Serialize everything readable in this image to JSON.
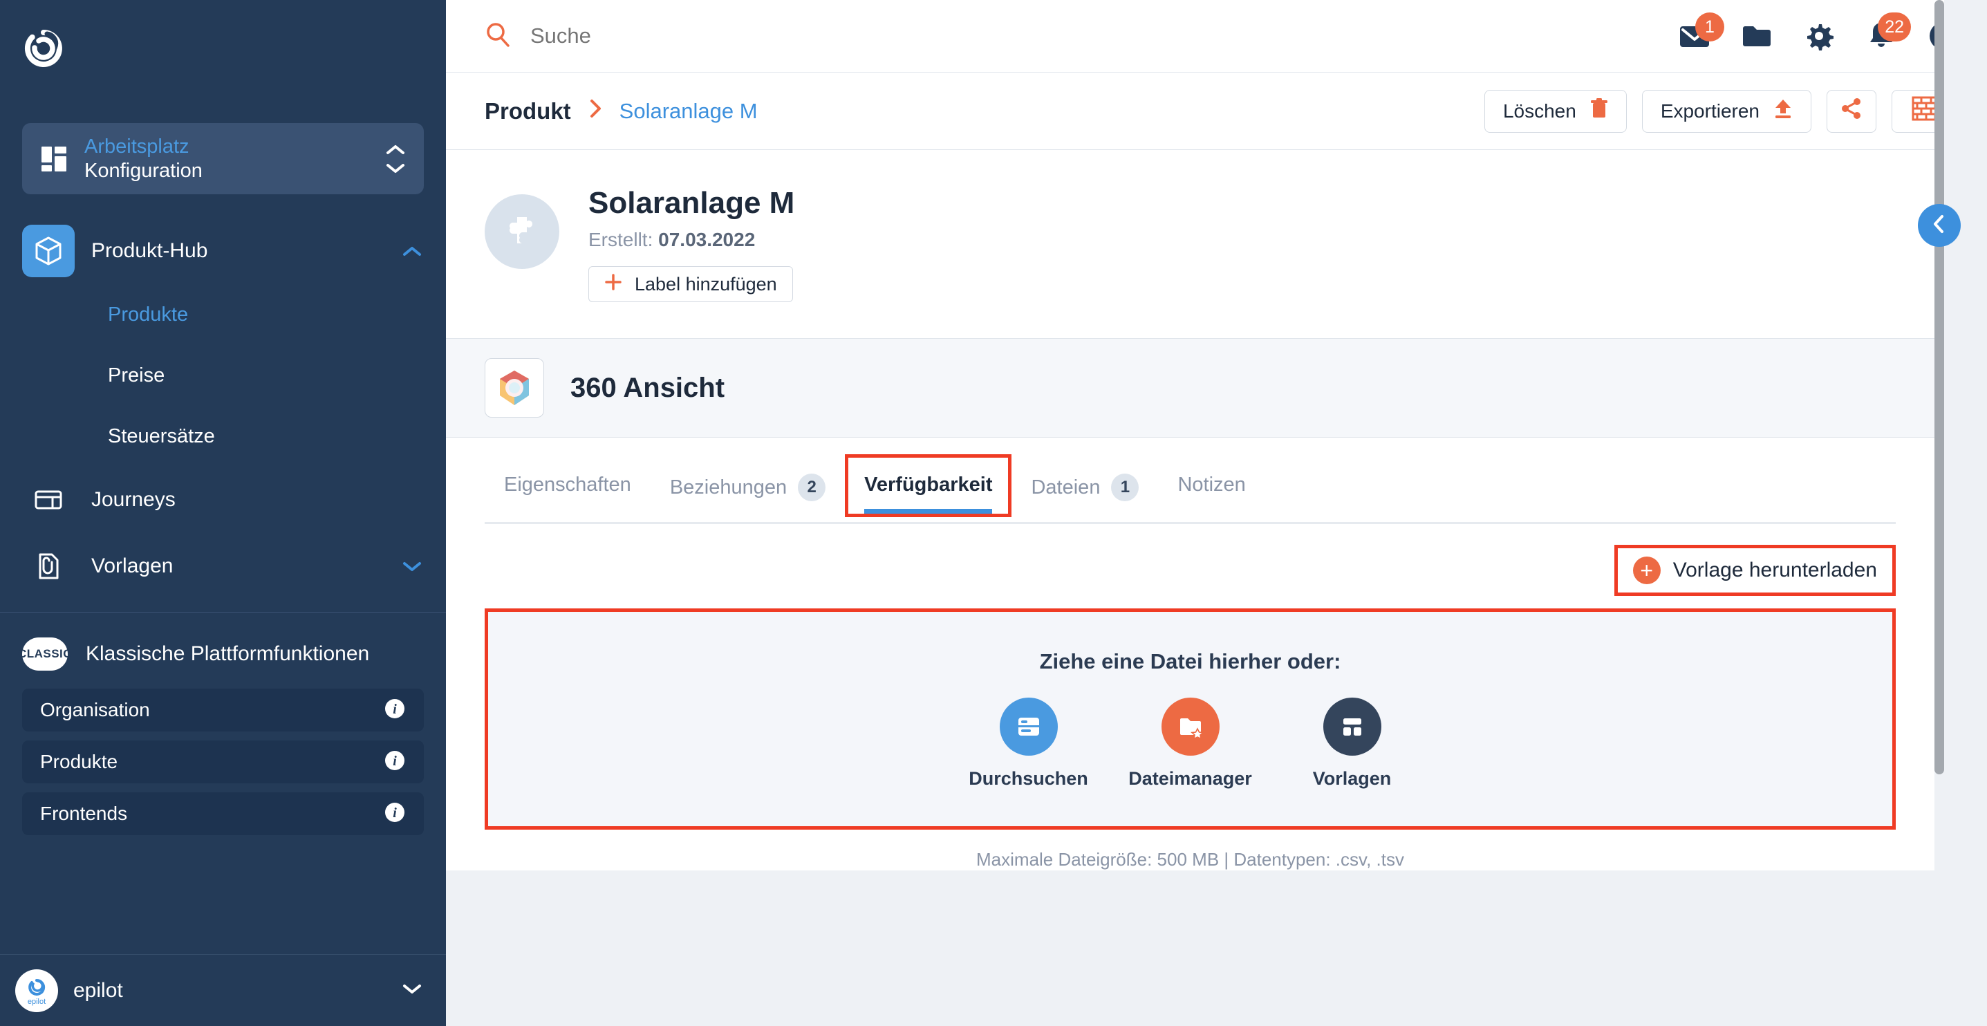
{
  "sidebar": {
    "logo_icon": "epilot-loop-logo",
    "workspace": {
      "top_label": "Arbeitsplatz",
      "bottom_label": "Konfiguration",
      "icon": "grid-dashboard-icon",
      "chevron_up_icon": "chevron-up-icon",
      "chevron_down_icon": "chevron-down-icon"
    },
    "nav": [
      {
        "label": "Produkt-Hub",
        "icon": "cube-icon",
        "active": true,
        "expanded": true,
        "chevron": "chevron-up-icon"
      },
      {
        "label": "Produkte",
        "sub": true,
        "active": true
      },
      {
        "label": "Preise",
        "sub": true,
        "active": false
      },
      {
        "label": "Steuersätze",
        "sub": true,
        "active": false
      },
      {
        "label": "Journeys",
        "icon": "journey-layout-icon",
        "active": false
      },
      {
        "label": "Vorlagen",
        "icon": "document-clip-icon",
        "active": false,
        "chevron": "chevron-down-icon"
      }
    ],
    "classic": {
      "pill_text": "CLASSIC",
      "title": "Klassische Plattformfunktionen",
      "items": [
        {
          "label": "Organisation",
          "info_icon": "info-icon"
        },
        {
          "label": "Produkte",
          "info_icon": "info-icon"
        },
        {
          "label": "Frontends",
          "info_icon": "info-icon"
        }
      ]
    },
    "footer": {
      "org_name": "epilot",
      "avatar_icon": "epilot-avatar-icon",
      "chevron_icon": "chevron-down-icon"
    }
  },
  "topbar": {
    "search_icon": "search-icon",
    "search_placeholder": "Suche",
    "search_value": "",
    "icons": [
      {
        "name": "mail-icon",
        "badge": "1"
      },
      {
        "name": "folder-icon",
        "badge": ""
      },
      {
        "name": "gear-icon",
        "badge": ""
      },
      {
        "name": "bell-icon",
        "badge": "22"
      },
      {
        "name": "info-icon",
        "badge": ""
      }
    ]
  },
  "breadcrumb": {
    "root": "Produkt",
    "separator_icon": "chevron-right-icon",
    "leaf": "Solaranlage M"
  },
  "actions": {
    "delete_label": "Löschen",
    "delete_icon": "trash-icon",
    "export_label": "Exportieren",
    "export_icon": "upload-icon",
    "share_icon": "share-icon",
    "blocks_icon": "brick-wall-icon"
  },
  "product": {
    "avatar_icon": "puzzle-piece-icon",
    "title": "Solaranlage M",
    "created_prefix": "Erstellt:",
    "created_date": "07.03.2022",
    "add_label_button": "Label hinzufügen",
    "add_label_icon": "plus-icon"
  },
  "view360": {
    "icon": "360-view-icon",
    "title": "360 Ansicht"
  },
  "tabs": [
    {
      "label": "Eigenschaften",
      "badge": "",
      "selected": false,
      "highlighted": false
    },
    {
      "label": "Beziehungen",
      "badge": "2",
      "selected": false,
      "highlighted": false
    },
    {
      "label": "Verfügbarkeit",
      "badge": "",
      "selected": true,
      "highlighted": true
    },
    {
      "label": "Dateien",
      "badge": "1",
      "selected": false,
      "highlighted": false
    },
    {
      "label": "Notizen",
      "badge": "",
      "selected": false,
      "highlighted": false
    }
  ],
  "availability": {
    "download_template_label": "Vorlage herunterladen",
    "download_template_icon": "plus-circle-icon",
    "dropzone_title": "Ziehe eine Datei hierher oder:",
    "options": [
      {
        "label": "Durchsuchen",
        "icon": "browse-files-icon",
        "color": "#4a9ae0"
      },
      {
        "label": "Dateimanager",
        "icon": "file-manager-star-icon",
        "color": "#ed6a43"
      },
      {
        "label": "Vorlagen",
        "icon": "templates-grid-icon",
        "color": "#34455c"
      }
    ],
    "footer_note": "Maximale Dateigröße: 500 MB  |  Datentypen: .csv, .tsv"
  },
  "panel": {
    "collapse_icon": "chevron-left-icon"
  },
  "colors": {
    "sidebar_bg": "#243b58",
    "accent_blue": "#3d90dd",
    "accent_orange": "#ed6a43",
    "highlight_red": "#ef3b24",
    "text_dark": "#1e2a3b",
    "text_muted": "#8a94a6"
  }
}
